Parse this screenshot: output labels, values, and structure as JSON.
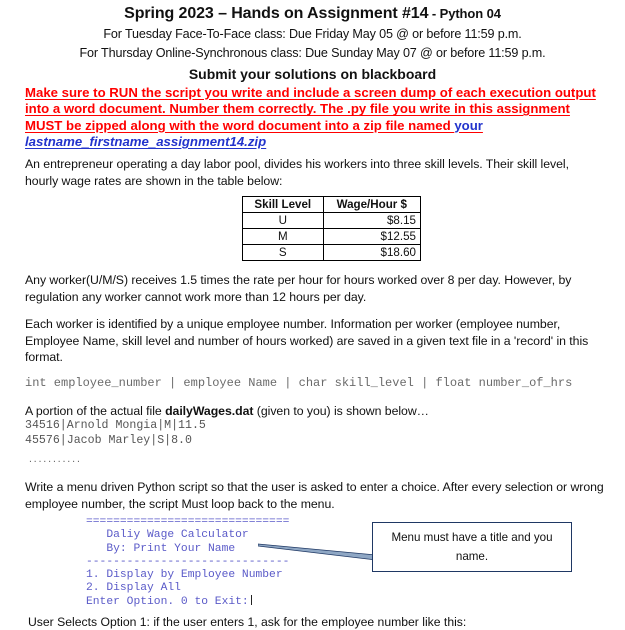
{
  "header": {
    "title_main": "Spring 2023 – Hands on Assignment #14",
    "title_suffix": " - Python 04",
    "due_line_1": "For Tuesday Face-To-Face class: Due Friday May 05 @ or before 11:59 p.m.",
    "due_line_2": "For Thursday Online-Synchronous class: Due Sunday May 07 @ or before 11:59 p.m.",
    "submit_line": "Submit your solutions on blackboard"
  },
  "warning": {
    "red_text": "Make sure to RUN the script you write and include a screen dump of each execution output into a word document. Number them correctly. The .py file you write in this assignment MUST be zipped along with the word document into a zip file named ",
    "blue_your": "your",
    "blue_filename": "lastname_firstname_assignment14.zip",
    "red_color": "#FF0000",
    "blue_color": "#2233CC"
  },
  "body": {
    "intro": "An entrepreneur operating a day labor pool, divides his workers into three skill levels. Their skill level, hourly wage rates are shown in the table below:",
    "overtime": "Any worker(U/M/S) receives 1.5 times the rate per hour for hours worked over 8 per day. However, by regulation any worker cannot work more than 12 hours per day.",
    "record_desc": "Each worker is identified by a unique employee number. Information per worker (employee number, Employee Name, skill level and number of hours worked) are saved in a given text file in a 'record' in this format.",
    "record_format": "int employee_number | employee Name | char skill_level | float number_of_hrs",
    "file_intro_pre": "A portion of the actual file ",
    "file_name": "dailyWages.dat",
    "file_intro_post": " (given to you) is shown below…",
    "file_line_1": "34516|Arnold Mongia|M|11.5",
    "file_line_2": "45576|Jacob Marley|S|8.0",
    "file_ellipsis": "...........",
    "menu_desc": "Write a menu driven Python script so that the user is asked to enter a choice. After every selection or wrong employee number, the script Must loop back to the menu.",
    "footer": "User Selects Option 1: if the user enters 1, ask for the employee number like this:"
  },
  "wage_table": {
    "headers": [
      "Skill Level",
      "Wage/Hour $"
    ],
    "rows": [
      {
        "level": "U",
        "wage": "$8.15"
      },
      {
        "level": "M",
        "wage": "$12.55"
      },
      {
        "level": "S",
        "wage": "$18.60"
      }
    ]
  },
  "menu_console": {
    "rule_top": "==============================",
    "title": "   Daliy Wage Calculator",
    "byline": "   By: Print Your Name",
    "rule_bottom": "------------------------------",
    "option_1": "1. Display by Employee Number",
    "option_2": "2. Display All",
    "prompt": "Enter Option. 0 to Exit:",
    "text_color": "#5a5ac8"
  },
  "callout": {
    "line_1": "Menu must have a title and you",
    "line_2": "name.",
    "border_color": "#1F3864"
  }
}
